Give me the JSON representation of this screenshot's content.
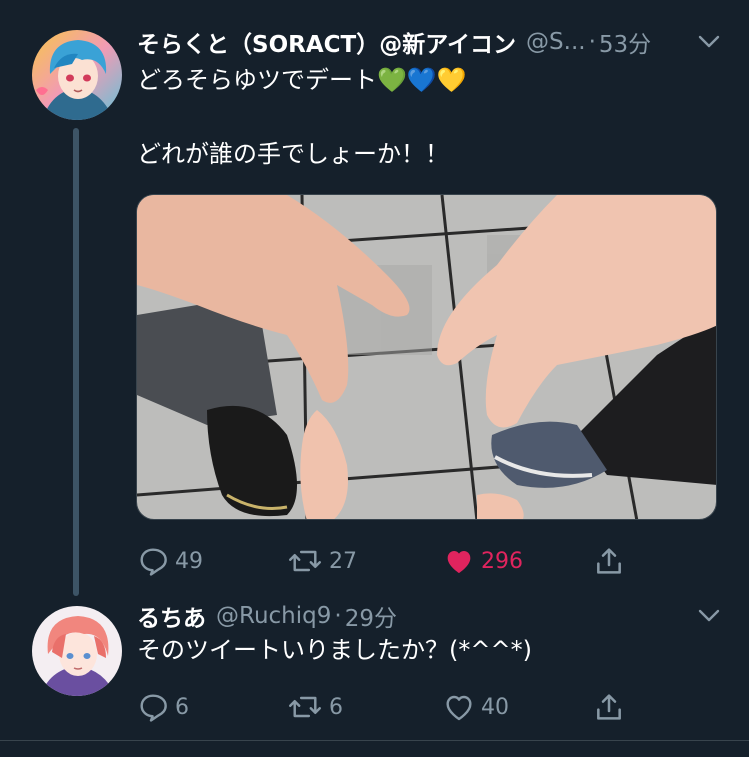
{
  "tweets": [
    {
      "display_name": "そらくと（SORACT）@新アイコン",
      "handle": "@S...",
      "dot": "·",
      "time": "53分",
      "text_lines": [
        "どろそらゆツでデート💚💙💛",
        "どれが誰の手でしょーか！！"
      ],
      "reply_count": "49",
      "retweet_count": "27",
      "like_count": "296",
      "liked": true,
      "avatar_icon": "avatar-blue-hair",
      "media": "photo-hands-heart"
    },
    {
      "display_name": "るちあ",
      "handle": "@Ruchiq9",
      "dot": "·",
      "time": "29分",
      "text_lines": [
        "そのツイートいりましたか？(*^^*)"
      ],
      "reply_count": "6",
      "retweet_count": "6",
      "like_count": "40",
      "liked": false,
      "avatar_icon": "avatar-pink-hair"
    }
  ],
  "colors": {
    "background": "#15202b",
    "secondary_text": "#8899a6",
    "like_active": "#e0245e",
    "thread_line": "#3d5466"
  },
  "icons": {
    "reply": "reply-icon",
    "retweet": "retweet-icon",
    "like": "heart-icon",
    "share": "share-icon",
    "more": "chevron-down-icon"
  }
}
